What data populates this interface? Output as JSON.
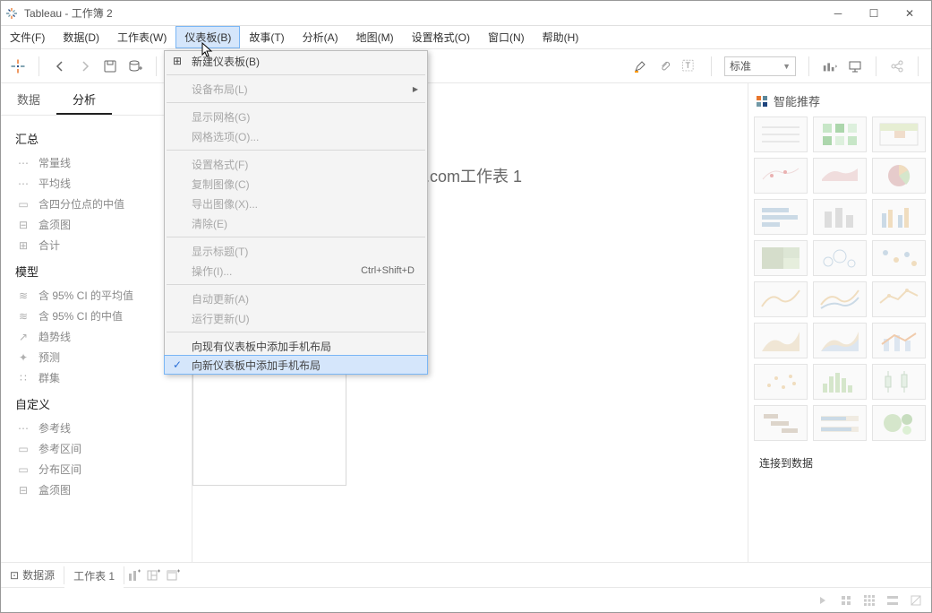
{
  "title": "Tableau - 工作簿 2",
  "menubar": [
    "文件(F)",
    "数据(D)",
    "工作表(W)",
    "仪表板(B)",
    "故事(T)",
    "分析(A)",
    "地图(M)",
    "设置格式(O)",
    "窗口(N)",
    "帮助(H)"
  ],
  "toolbar_select": "标准",
  "left_tabs": {
    "data": "数据",
    "analysis": "分析"
  },
  "left_sections": {
    "summary": {
      "h": "汇总",
      "items": [
        "常量线",
        "平均线",
        "含四分位点的中值",
        "盒须图",
        "合计"
      ]
    },
    "model": {
      "h": "模型",
      "items": [
        "含 95% CI 的平均值",
        "含 95% CI 的中值",
        "趋势线",
        "预测",
        "群集"
      ]
    },
    "custom": {
      "h": "自定义",
      "items": [
        "参考线",
        "参考区间",
        "分布区间",
        "盒须图"
      ]
    }
  },
  "canvas_title": ".com工作表 1",
  "right_head": "智能推荐",
  "right_msg": "连接到数据",
  "bottom": {
    "datasrc": "数据源",
    "sheet": "工作表 1"
  },
  "dropdown": {
    "new_dashboard": "新建仪表板(B)",
    "device_layout": "设备布局(L)",
    "show_grid": "显示网格(G)",
    "grid_options": "网格选项(O)...",
    "format": "设置格式(F)",
    "copy_image": "复制图像(C)",
    "export_image": "导出图像(X)...",
    "clear": "清除(E)",
    "show_title": "显示标题(T)",
    "actions": "操作(I)...",
    "actions_shortcut": "Ctrl+Shift+D",
    "auto_update": "自动更新(A)",
    "run_update": "运行更新(U)",
    "add_phone_existing": "向现有仪表板中添加手机布局",
    "add_phone_new": "向新仪表板中添加手机布局"
  }
}
